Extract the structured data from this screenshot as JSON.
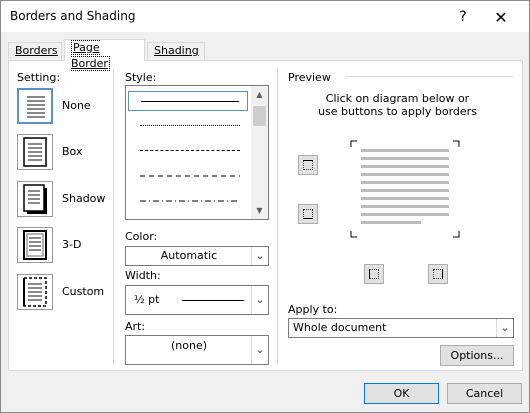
{
  "window": {
    "title": "Borders and Shading",
    "help_glyph": "?",
    "close_glyph": "✕"
  },
  "tabs": [
    {
      "label": "Borders",
      "active": false
    },
    {
      "label": "Page Border",
      "active": true
    },
    {
      "label": "Shading",
      "active": false
    }
  ],
  "setting": {
    "heading": "Setting:",
    "items": [
      {
        "label": "None",
        "selected": true
      },
      {
        "label": "Box",
        "selected": false
      },
      {
        "label": "Shadow",
        "selected": false
      },
      {
        "label": "3-D",
        "selected": false
      },
      {
        "label": "Custom",
        "selected": false
      }
    ]
  },
  "style": {
    "heading": "Style:",
    "line_styles": [
      "solid",
      "dotted",
      "dashed-small",
      "dashed",
      "dash-dot"
    ]
  },
  "color": {
    "label": "Color:",
    "value": "Automatic"
  },
  "width": {
    "label": "Width:",
    "value": "½ pt"
  },
  "art": {
    "label": "Art:",
    "value": "(none)"
  },
  "preview": {
    "heading": "Preview",
    "instructions_line1": "Click on diagram below or",
    "instructions_line2": "use buttons to apply borders"
  },
  "apply_to": {
    "label": "Apply to:",
    "value": "Whole document"
  },
  "buttons": {
    "options": "Options...",
    "ok": "OK",
    "cancel": "Cancel"
  },
  "colors": {
    "selection_blue": "#5a8fd0",
    "ok_border": "#0078d7"
  }
}
